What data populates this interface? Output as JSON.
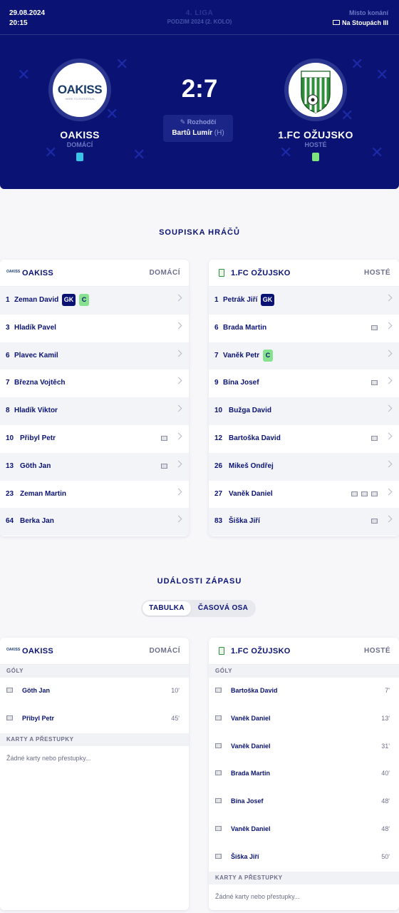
{
  "header": {
    "date": "29.08.2024",
    "time": "20:15",
    "league": "4. LIGA",
    "season": "PODZIM 2024 (2. KOLO)",
    "venue_label": "Místo konání",
    "venue": "Na Stoupách III",
    "score": "2:7",
    "referee_label": "Rozhodčí",
    "referee_name": "Bartů Lumír",
    "referee_role": "(H)",
    "home": {
      "name": "OAKISS",
      "role": "DOMÁCÍ",
      "logo_text": "OAKISS",
      "logo_sub": "HERE TO ENTERTAIN",
      "jersey_color": "#39c3e6"
    },
    "away": {
      "name": "1.FC OŽUJSKO",
      "role": "HOSTÉ",
      "jersey_color": "#7de37d"
    }
  },
  "lineup": {
    "title": "SOUPISKA HRÁČŮ",
    "home": {
      "name": "OAKISS",
      "role": "DOMÁCÍ",
      "logo_text": "OAKISS",
      "players": [
        {
          "number": "1",
          "name": "Zeman David",
          "badges": [
            "GK",
            "C"
          ],
          "goals": 0
        },
        {
          "number": "3",
          "name": "Hladík Pavel",
          "badges": [],
          "goals": 0
        },
        {
          "number": "6",
          "name": "Plavec Kamil",
          "badges": [],
          "goals": 0
        },
        {
          "number": "7",
          "name": "Března Vojtěch",
          "badges": [],
          "goals": 0
        },
        {
          "number": "8",
          "name": "Hladík Viktor",
          "badges": [],
          "goals": 0
        },
        {
          "number": "10",
          "name": "Přibyl Petr",
          "badges": [],
          "goals": 1
        },
        {
          "number": "13",
          "name": "Göth Jan",
          "badges": [],
          "goals": 1
        },
        {
          "number": "23",
          "name": "Zeman Martin",
          "badges": [],
          "goals": 0
        },
        {
          "number": "64",
          "name": "Berka Jan",
          "badges": [],
          "goals": 0
        }
      ]
    },
    "away": {
      "name": "1.FC OŽUJSKO",
      "role": "HOSTÉ",
      "players": [
        {
          "number": "1",
          "name": "Petrák Jiří",
          "badges": [
            "GK"
          ],
          "goals": 0
        },
        {
          "number": "6",
          "name": "Brada Martin",
          "badges": [],
          "goals": 1
        },
        {
          "number": "7",
          "name": "Vaněk Petr",
          "badges": [
            "C"
          ],
          "goals": 0
        },
        {
          "number": "9",
          "name": "Bína Josef",
          "badges": [],
          "goals": 1
        },
        {
          "number": "10",
          "name": "Bužga David",
          "badges": [],
          "goals": 0
        },
        {
          "number": "12",
          "name": "Bartoška David",
          "badges": [],
          "goals": 1
        },
        {
          "number": "26",
          "name": "Mikeš Ondřej",
          "badges": [],
          "goals": 0
        },
        {
          "number": "27",
          "name": "Vaněk Daniel",
          "badges": [],
          "goals": 3
        },
        {
          "number": "83",
          "name": "Šiška Jiří",
          "badges": [],
          "goals": 1
        }
      ]
    }
  },
  "events": {
    "title": "UDÁLOSTI ZÁPASU",
    "tabs": [
      "TABULKA",
      "ČASOVÁ OSA"
    ],
    "active_tab": "TABULKA",
    "goals_label": "GÓLY",
    "cards_label": "KARTY A PŘESTUPKY",
    "no_cards": "Žádné karty nebo přestupky...",
    "home": {
      "name": "OAKISS",
      "role": "DOMÁCÍ",
      "logo_text": "OAKISS",
      "goals": [
        {
          "name": "Göth Jan",
          "minute": "10'"
        },
        {
          "name": "Přibyl Petr",
          "minute": "45'"
        }
      ]
    },
    "away": {
      "name": "1.FC OŽUJSKO",
      "role": "HOSTÉ",
      "goals": [
        {
          "name": "Bartoška David",
          "minute": "7'"
        },
        {
          "name": "Vaněk Daniel",
          "minute": "13'"
        },
        {
          "name": "Vaněk Daniel",
          "minute": "31'"
        },
        {
          "name": "Brada Martin",
          "minute": "40'"
        },
        {
          "name": "Bína Josef",
          "minute": "48'"
        },
        {
          "name": "Vaněk Daniel",
          "minute": "48'"
        },
        {
          "name": "Šiška Jiří",
          "minute": "50'"
        }
      ]
    }
  }
}
